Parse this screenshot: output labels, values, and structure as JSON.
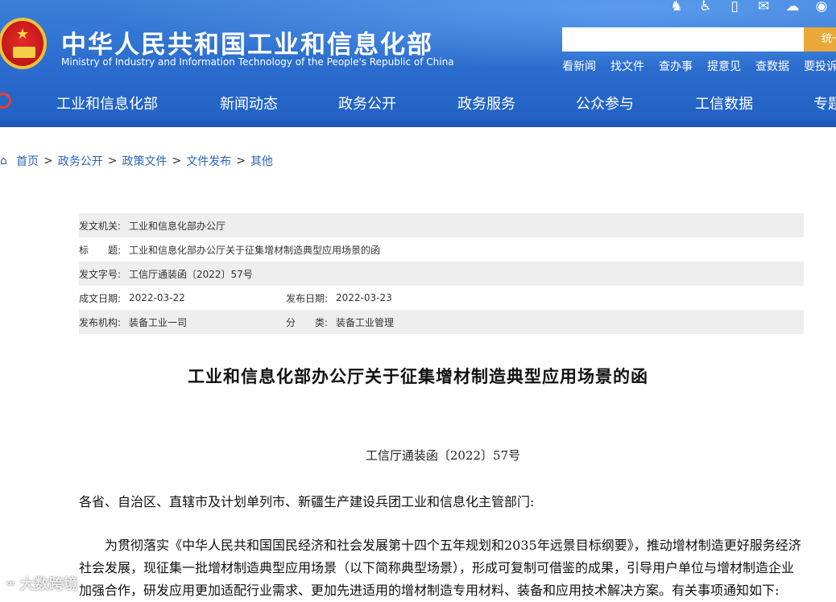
{
  "header": {
    "title": "中华人民共和国工业和信息化部",
    "subtitle": "Ministry of Industry and Information Technology of the People's Republic of China",
    "search_placeholder": "",
    "search_button": "统一",
    "tool_icons": [
      "mascot-icon",
      "accessibility-icon",
      "mobile-icon",
      "mail-icon",
      "wechat-icon",
      "weibo-icon"
    ],
    "quick_links": [
      "看新闻",
      "找文件",
      "查办事",
      "提意见",
      "查数据",
      "要投诉"
    ]
  },
  "nav": {
    "items": [
      "工业和信息化部",
      "新闻动态",
      "政务公开",
      "政务服务",
      "公众参与",
      "工信数据",
      "专题"
    ]
  },
  "breadcrumb": {
    "items": [
      "首页",
      "政务公开",
      "政策文件",
      "文件发布",
      "其他"
    ],
    "separator": ">"
  },
  "meta": {
    "issuer_label": "发文机关:",
    "issuer": "工业和信息化部办公厅",
    "title_label": "标　　题:",
    "title": "工业和信息化部办公厅关于征集增材制造典型应用场景的函",
    "docno_label": "发文字号:",
    "docno": "工信厅通装函〔2022〕57号",
    "created_label": "成文日期:",
    "created": "2022-03-22",
    "published_label": "发布日期:",
    "published": "2022-03-23",
    "org_label": "发布机构:",
    "org": "装备工业一司",
    "category_label": "分　　类:",
    "category": "装备工业管理"
  },
  "document": {
    "title": "工业和信息化部办公厅关于征集增材制造典型应用场景的函",
    "number": "工信厅通装函〔2022〕57号",
    "salutation": "各省、自治区、直辖市及计划单列市、新疆生产建设兵团工业和信息化主管部门:",
    "paragraph1": "为贯彻落实《中华人民共和国国民经济和社会发展第十四个五年规划和2035年远景目标纲要》，推动增材制造更好服务经济社会发展，现征集一批增材制造典型应用场景（以下简称典型场景），形成可复制可借鉴的成果，引导用户单位与增材制造企业加强合作，研发应用更加适配行业需求、更加先进适用的增材制造专用材料、装备和应用技术解决方案。有关事项通知如下:"
  },
  "watermark": {
    "text": "大数跨境"
  }
}
